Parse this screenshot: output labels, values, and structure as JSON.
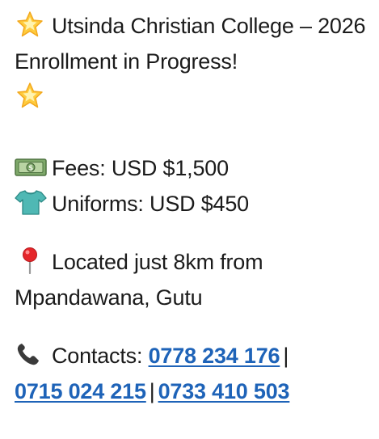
{
  "message": {
    "title_line": "Utsinda Christian College – 2026 Enrollment in Progress!",
    "fees": "Fees: USD $1,500",
    "uniforms": "Uniforms: USD $450",
    "location": "Located just 8km from Mpandawana, Gutu",
    "contacts_label": "Contacts:",
    "separator": "|",
    "phones": [
      "0778 234 176",
      "0715 024 215",
      "0733 410 503"
    ]
  },
  "icons": {
    "title_start": "glowing-star-icon",
    "title_end": "glowing-star-icon",
    "fees": "dollar-banknote-icon",
    "uniforms": "t-shirt-icon",
    "location": "round-pushpin-icon",
    "contacts": "telephone-receiver-icon"
  },
  "colors": {
    "text": "#1b1b1b",
    "link": "#1e63b8",
    "background": "#ffffff"
  }
}
